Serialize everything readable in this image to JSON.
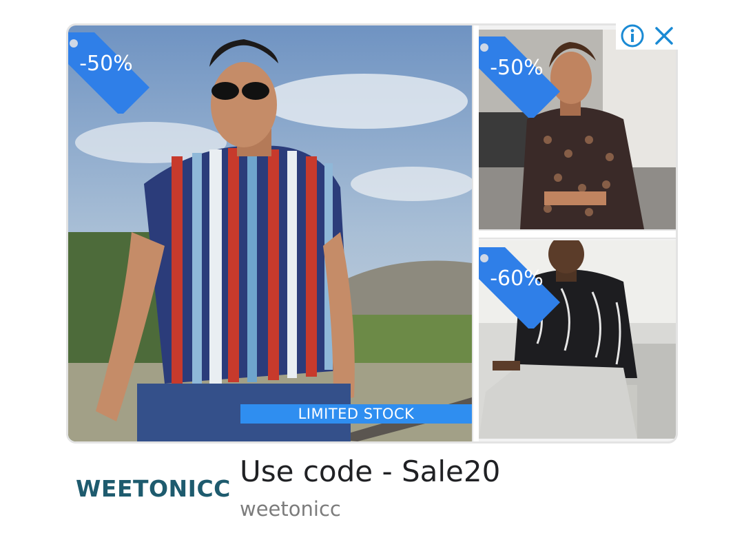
{
  "colors": {
    "tag_blue": "#2f7fe8",
    "banner_blue": "#2f8ef0",
    "brand_teal": "#1e5b6e",
    "ad_control_blue": "#1a8ad4"
  },
  "ad": {
    "main": {
      "discount": "-50%",
      "banner": "LIMITED STOCK"
    },
    "top_right": {
      "discount": "-50%"
    },
    "bottom_right": {
      "discount": "-60%"
    },
    "controls": {
      "info_icon": "info-icon",
      "close_icon": "close-icon"
    }
  },
  "footer": {
    "brand_logo": "WEETONICC",
    "headline": "Use code - Sale20",
    "advertiser": "weetonicc"
  }
}
